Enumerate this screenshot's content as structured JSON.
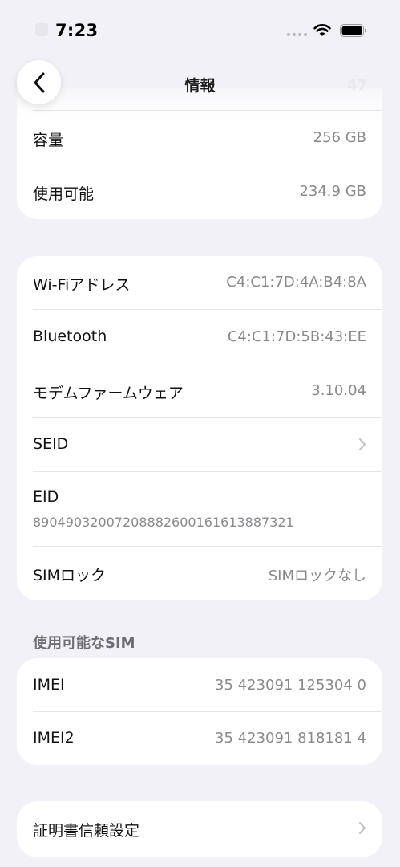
{
  "status_bar": {
    "time": "7:23"
  },
  "nav": {
    "title": "情報",
    "faded_number": "47"
  },
  "storage": {
    "rows": [
      {
        "label": "容量",
        "value": "256 GB"
      },
      {
        "label": "使用可能",
        "value": "234.9 GB"
      }
    ]
  },
  "network": {
    "wifi": {
      "label": "Wi-Fiアドレス",
      "value": "C4:C1:7D:4A:B4:8A"
    },
    "bluetooth": {
      "label": "Bluetooth",
      "value": "C4:C1:7D:5B:43:EE"
    },
    "modem": {
      "label": "モデムファームウェア",
      "value": "3.10.04"
    },
    "seid": {
      "label": "SEID"
    },
    "eid": {
      "label": "EID",
      "value": "89049032007208882600161613887321"
    },
    "sim_lock": {
      "label": "SIMロック",
      "value": "SIMロックなし"
    }
  },
  "available_sim": {
    "header": "使用可能なSIM",
    "imei": {
      "label": "IMEI",
      "value": "35 423091 125304 0"
    },
    "imei2": {
      "label": "IMEI2",
      "value": "35 423091 818181 4"
    }
  },
  "certificate": {
    "label": "証明書信頼設定"
  },
  "colors": {
    "background": "#f2f1f7",
    "card": "#ffffff",
    "secondary_text": "#8a8a8e",
    "chevron": "#c4c4c8"
  },
  "icons": [
    "back-chevron-icon",
    "wifi-icon",
    "battery-icon",
    "chevron-right-icon"
  ]
}
